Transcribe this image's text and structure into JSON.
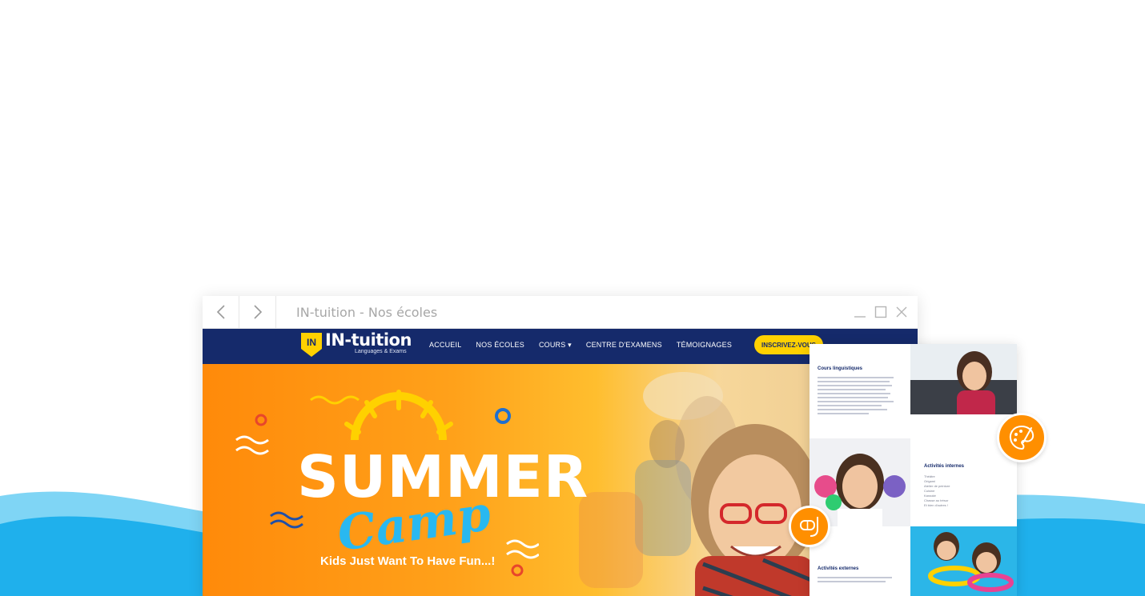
{
  "window": {
    "title": "IN-tuition - Nos écoles"
  },
  "site": {
    "logo_name": "IN-tuition",
    "logo_badge": "IN",
    "logo_tagline": "Languages & Exams",
    "menu": [
      "ACCUEIL",
      "NOS ÉCOLES",
      "COURS ▾",
      "CENTRE D'EXAMENS",
      "TÉMOIGNAGES"
    ],
    "cta_label": "INSCRIVEZ-VOUS"
  },
  "hero": {
    "headline": "SUMMER",
    "script": "Camp",
    "tagline": "Kids Just Want To Have Fun...!"
  },
  "card": {
    "cours_title": "Cours linguistiques",
    "internes_title": "Activités internes",
    "internes_items": [
      "Théâtre",
      "Origami",
      "Atelier de peinture",
      "Cuisine",
      "Karaoké",
      "Chasse au trésor",
      "Et bien d'autres !"
    ],
    "externes_title": "Activités externes"
  },
  "colors": {
    "navy": "#152a6b",
    "orange": "#ff8f00",
    "yellow": "#ffd100",
    "sky": "#29b8f0"
  },
  "icons": {
    "palette_badge": "palette-icon",
    "snorkel_badge": "snorkel-mask-icon"
  }
}
